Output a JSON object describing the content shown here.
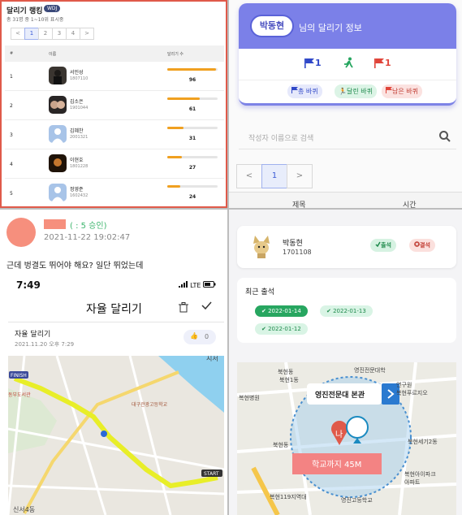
{
  "ranking": {
    "title": "달리기 랭킹",
    "badge": "WDJ",
    "subtitle": "총 31명 중 1~10위 표시중",
    "pager": [
      "<",
      "1",
      "2",
      "3",
      "4",
      ">"
    ],
    "head_num": "#",
    "head_name": "이름",
    "head_count": "달리기 수",
    "rows": [
      {
        "rank": "1",
        "name": "서민성",
        "id": "1807110",
        "count": "96",
        "fill": 0.97
      },
      {
        "rank": "2",
        "name": "김소은",
        "id": "1901044",
        "count": "61",
        "fill": 0.64
      },
      {
        "rank": "3",
        "name": "김혜찬",
        "id": "2001321",
        "count": "31",
        "fill": 0.33
      },
      {
        "rank": "4",
        "name": "이현호",
        "id": "1801228",
        "count": "27",
        "fill": 0.29
      },
      {
        "rank": "5",
        "name": "정영준",
        "id": "1602432",
        "count": "24",
        "fill": 0.26
      }
    ]
  },
  "profile": {
    "name": "박동현",
    "desc": "님의 달리기 정보",
    "stats": [
      "1",
      "1"
    ],
    "tags": [
      "총 바퀴",
      "달린 바퀴",
      "남은 바퀴"
    ],
    "search_placeholder": "작성자 이름으로 검색",
    "pager": [
      "<",
      "1",
      ">"
    ],
    "col_title": "제목",
    "col_time": "시간",
    "colors": {
      "accent": "#7b80e8",
      "blue": "#3048c8",
      "green": "#27a660",
      "red": "#e0453a"
    }
  },
  "post": {
    "meta": "( : 5 승인)",
    "date": "2021-11-22 19:02:47",
    "text": "근데 벙결도 뛰어야 해요? 일단 뛰었는데",
    "phone": {
      "time": "7:49",
      "status": "LTE",
      "title": "자율 달리기",
      "activity": "자율 달리기",
      "activity_date": "2021.11.20 오후 7:29",
      "likes": "0",
      "map_finish": "FINISH",
      "map_start": "START",
      "map_label_school": "대구관광고등학교",
      "map_label_shop": "동부도서관",
      "map_label_stop": "시서",
      "map_label_bottom": "신서4동"
    }
  },
  "attendance": {
    "name": "박동현",
    "id": "1701108",
    "present": "출석",
    "absent": "결석",
    "recent_title": "최근 출석",
    "dates": [
      "2022-01-14",
      "2022-01-13",
      "2022-01-12"
    ],
    "map": {
      "place": "영진전문대 본관",
      "distance": "학교까지 45M",
      "me": "나",
      "labels": [
        "북현동",
        "북현1동",
        "복현푸르지오",
        "영진전문대학",
        "복현병원",
        "복현세기2동",
        "복현아이파크",
        "아파트",
        "복현119지역대",
        "영진고등학교",
        "북현동",
        "연구원"
      ]
    }
  }
}
